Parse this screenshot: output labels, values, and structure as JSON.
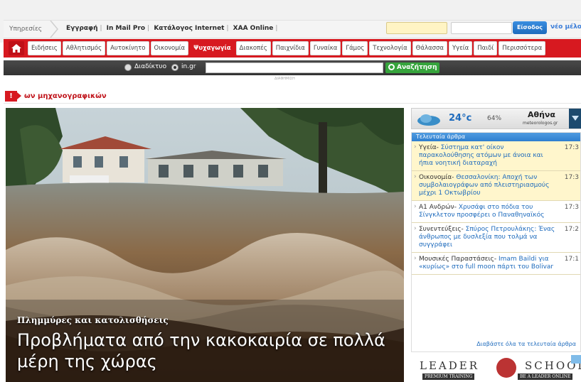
{
  "services": {
    "label": "Υπηρεσίες",
    "links": [
      "Εγγραφή",
      "In Mail Pro",
      "Κατάλογος Internet",
      "ΧΑΑ Online"
    ],
    "login_button": "Είσοδος",
    "new_member": "νέο μέλος"
  },
  "nav": {
    "items": [
      "Ειδήσεις",
      "Αθλητισμός",
      "Αυτοκίνητο",
      "Οικονομία",
      "Ψυχαγωγία",
      "Διακοπές",
      "Παιχνίδια",
      "Γυναίκα",
      "Γάμος",
      "Τεχνολογία",
      "Θάλασσα",
      "Υγεία",
      "Παιδί",
      "Περισσότερα"
    ],
    "active": "Ψυχαγωγία",
    "hovered": "Οικονομία"
  },
  "search": {
    "option_web": "Διαδίκτυο",
    "option_site": "in.gr",
    "button": "Αναζήτηση",
    "ad_label": "ΔΙΑΦΗΜΙΣΗ"
  },
  "ticker": {
    "badge": "!",
    "text": "ων μηχανογραφικών"
  },
  "hero": {
    "kicker": "Πλημμύρες και κατολισθήσεις",
    "title": "Προβλήματα από την κακοκαιρία σε πολλά μέρη της χώρας"
  },
  "weather": {
    "temperature": "24°c",
    "humidity": "64%",
    "city": "Αθήνα",
    "site": "meteorologos.gr"
  },
  "latest": {
    "header": "Τελευταία άρθρα",
    "items": [
      {
        "category": "Υγεία-",
        "title": "Σύστημα κατ' οίκον παρακολούθησης ατόμων με άνοια και ήπια νοητική διαταραχή",
        "time": "17:3",
        "highlight": true
      },
      {
        "category": "Οικονομία-",
        "title": "Θεσσαλονίκη: Αποχή των συμβολαιογράφων από πλειστηριασμούς μέχρι 1 Οκτωβρίου",
        "time": "17:3",
        "highlight": true
      },
      {
        "category": "Α1 Ανδρών-",
        "title": "Χρυσάφι στο πόδια του Σίνγκλετον προσφέρει ο Παναθηναϊκός",
        "time": "17:3",
        "highlight": false
      },
      {
        "category": "Συνεντεύξεις-",
        "title": "Σπύρος Πετρουλάκης: Ένας άνθρωπος με δυσλεξία που τολμά να συγγράφει",
        "time": "17:2",
        "highlight": false
      },
      {
        "category": "Μουσικές Παραστάσεις-",
        "title": "Imam Baildi για «κυρίως» στο full moon πάρτι του Bolivar",
        "time": "17:1",
        "highlight": false
      }
    ],
    "read_all": "Διαβάστε όλα τα τελευταία άρθρα"
  },
  "ad": {
    "left": "LEADER",
    "right": "SCHOOL",
    "sub_left": "PREMIUM TRAINING",
    "sub_right": "BE A LEADER ONLINE"
  },
  "colors": {
    "brand_red": "#d71920",
    "link_blue": "#1e6bbd",
    "search_green": "#36a43c",
    "highlight_yellow": "#fff6cc"
  }
}
